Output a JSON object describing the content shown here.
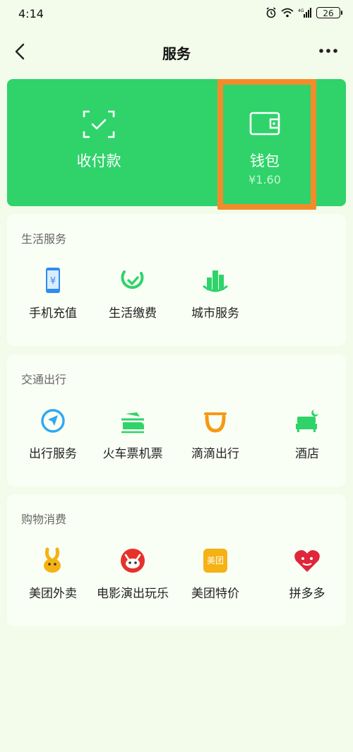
{
  "status_bar": {
    "time": "4:14",
    "battery": "26"
  },
  "nav": {
    "title": "服务"
  },
  "top_card": {
    "items": [
      {
        "label": "收付款",
        "icon": "scan-pay-icon"
      },
      {
        "label": "钱包",
        "sub": "¥1.60",
        "icon": "wallet-icon"
      }
    ]
  },
  "sections": [
    {
      "title": "生活服务",
      "items": [
        {
          "label": "手机充值",
          "icon": "phone-recharge-icon"
        },
        {
          "label": "生活缴费",
          "icon": "utility-payment-icon"
        },
        {
          "label": "城市服务",
          "icon": "city-services-icon"
        }
      ]
    },
    {
      "title": "交通出行",
      "items": [
        {
          "label": "出行服务",
          "icon": "travel-service-icon"
        },
        {
          "label": "火车票机票",
          "icon": "train-plane-ticket-icon"
        },
        {
          "label": "滴滴出行",
          "icon": "didi-icon"
        },
        {
          "label": "酒店",
          "icon": "hotel-icon"
        }
      ]
    },
    {
      "title": "购物消费",
      "items": [
        {
          "label": "美团外卖",
          "icon": "meituan-delivery-icon"
        },
        {
          "label": "电影演出玩乐",
          "icon": "movie-entertainment-icon"
        },
        {
          "label": "美团特价",
          "icon": "meituan-deals-icon",
          "icon_text": "美团"
        },
        {
          "label": "拼多多",
          "icon": "pinduoduo-icon"
        }
      ]
    }
  ],
  "colors": {
    "brand_green": "#2fd36a",
    "highlight_orange": "#f48b2a",
    "background": "#f3fbea"
  }
}
